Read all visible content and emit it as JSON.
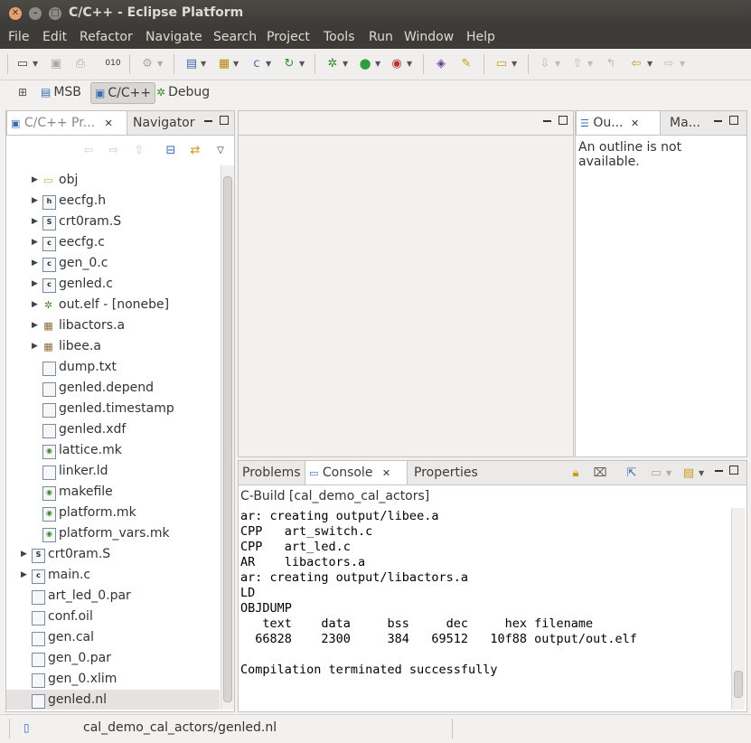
{
  "window": {
    "title": "C/C++ - Eclipse Platform"
  },
  "menu": [
    "File",
    "Edit",
    "Refactor",
    "Navigate",
    "Search",
    "Project",
    "Tools",
    "Run",
    "Window",
    "Help"
  ],
  "perspectives": {
    "open_icon": "open-perspective-icon",
    "msb": "MSB",
    "cpp": "C/C++",
    "debug": "Debug"
  },
  "explorer": {
    "tab_project": "C/C++ Pr...",
    "tab_navigator": "Navigator",
    "items": [
      {
        "label": "obj",
        "icon": "folder-icon",
        "expander": true,
        "indent": 1
      },
      {
        "label": "eecfg.h",
        "icon": "h-file-icon",
        "expander": true,
        "indent": 1
      },
      {
        "label": "crt0ram.S",
        "icon": "s-file-icon",
        "expander": true,
        "indent": 1
      },
      {
        "label": "eecfg.c",
        "icon": "c-file-icon",
        "expander": true,
        "indent": 1
      },
      {
        "label": "gen_0.c",
        "icon": "c-file-icon",
        "expander": true,
        "indent": 1
      },
      {
        "label": "genled.c",
        "icon": "c-file-icon",
        "expander": true,
        "indent": 1
      },
      {
        "label": "out.elf - [nonebe]",
        "icon": "binary-icon",
        "expander": true,
        "indent": 1
      },
      {
        "label": "libactors.a",
        "icon": "archive-icon",
        "expander": true,
        "indent": 1
      },
      {
        "label": "libee.a",
        "icon": "archive-icon",
        "expander": true,
        "indent": 1
      },
      {
        "label": "dump.txt",
        "icon": "text-file-icon",
        "expander": false,
        "indent": 1
      },
      {
        "label": "genled.depend",
        "icon": "text-file-icon",
        "expander": false,
        "indent": 1
      },
      {
        "label": "genled.timestamp",
        "icon": "text-file-icon",
        "expander": false,
        "indent": 1
      },
      {
        "label": "genled.xdf",
        "icon": "text-file-icon",
        "expander": false,
        "indent": 1
      },
      {
        "label": "lattice.mk",
        "icon": "make-file-icon",
        "expander": false,
        "indent": 1
      },
      {
        "label": "linker.ld",
        "icon": "text-file-icon",
        "expander": false,
        "indent": 1
      },
      {
        "label": "makefile",
        "icon": "make-file-icon",
        "expander": false,
        "indent": 1
      },
      {
        "label": "platform.mk",
        "icon": "make-file-icon",
        "expander": false,
        "indent": 1
      },
      {
        "label": "platform_vars.mk",
        "icon": "make-file-icon",
        "expander": false,
        "indent": 1
      },
      {
        "label": "crt0ram.S",
        "icon": "s-file-icon",
        "expander": true,
        "indent": 0
      },
      {
        "label": "main.c",
        "icon": "c-file-icon",
        "expander": true,
        "indent": 0
      },
      {
        "label": "art_led_0.par",
        "icon": "text-file-icon",
        "expander": false,
        "indent": 0
      },
      {
        "label": "conf.oil",
        "icon": "text-file-icon",
        "expander": false,
        "indent": 0
      },
      {
        "label": "gen.cal",
        "icon": "text-file-icon",
        "expander": false,
        "indent": 0
      },
      {
        "label": "gen_0.par",
        "icon": "text-file-icon",
        "expander": false,
        "indent": 0
      },
      {
        "label": "gen_0.xlim",
        "icon": "text-file-icon",
        "expander": false,
        "indent": 0
      },
      {
        "label": "genled.nl",
        "icon": "text-file-icon",
        "expander": false,
        "indent": 0,
        "selected": true
      }
    ]
  },
  "outline": {
    "tab_outline": "Ou...",
    "tab_make": "Ma...",
    "message": "An outline is not available."
  },
  "console": {
    "tab_problems": "Problems",
    "tab_console": "Console",
    "tab_properties": "Properties",
    "header": "C-Build [cal_demo_cal_actors]",
    "lines": [
      "ar: creating output/libee.a",
      "CPP   art_switch.c",
      "CPP   art_led.c",
      "AR    libactors.a",
      "ar: creating output/libactors.a",
      "LD",
      "OBJDUMP",
      "   text    data     bss     dec     hex filename",
      "  66828    2300     384   69512   10f88 output/out.elf",
      "",
      "Compilation terminated successfully"
    ]
  },
  "status": {
    "text": "cal_demo_cal_actors/genled.nl"
  }
}
